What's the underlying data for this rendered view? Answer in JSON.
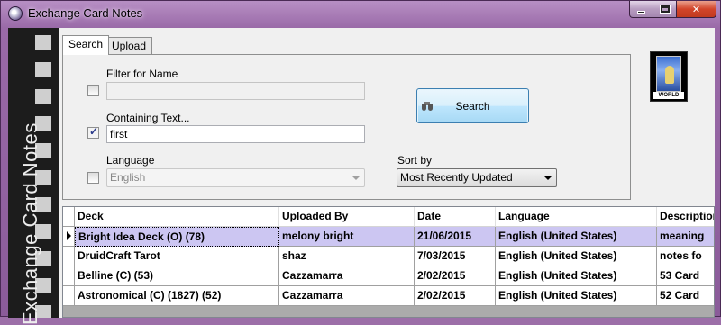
{
  "window": {
    "title": "Exchange Card Notes",
    "sidebar_text": "Exchange Card Notes",
    "card_thumb_label": "WORLD",
    "close_glyph": "✕"
  },
  "tabs": {
    "search": "Search",
    "upload": "Upload Card Data"
  },
  "search_panel": {
    "filter_name_label": "Filter for Name",
    "filter_name_checked": false,
    "filter_name_value": "",
    "containing_text_label": "Containing Text...",
    "containing_text_checked": true,
    "containing_text_value": "first",
    "language_label": "Language",
    "language_checked": false,
    "language_value": "English",
    "sort_by_label": "Sort by",
    "sort_by_value": "Most Recently Updated",
    "search_button": "Search"
  },
  "grid": {
    "columns": [
      "Deck",
      "Uploaded By",
      "Date",
      "Language",
      "Description"
    ],
    "rows": [
      {
        "deck": "Bright Idea Deck (O) (78)",
        "uploaded_by": "melony bright",
        "date": "21/06/2015",
        "language": "English (United States)",
        "description": "meaning",
        "selected": true
      },
      {
        "deck": "DruidCraft Tarot",
        "uploaded_by": "shaz",
        "date": "7/03/2015",
        "language": "English (United States)",
        "description": "notes fo",
        "selected": false
      },
      {
        "deck": "Belline (C) (53)",
        "uploaded_by": "Cazzamarra",
        "date": "2/02/2015",
        "language": "English (United States)",
        "description": "53 Card",
        "selected": false
      },
      {
        "deck": "Astronomical (C) (1827) (52)",
        "uploaded_by": "Cazzamarra",
        "date": "2/02/2015",
        "language": "English (United States)",
        "description": "52 Card",
        "selected": false
      }
    ]
  },
  "colors": {
    "frame": "#9a6aa8",
    "selected_row": "#ccc6f2",
    "button_border": "#3c7fb1"
  }
}
